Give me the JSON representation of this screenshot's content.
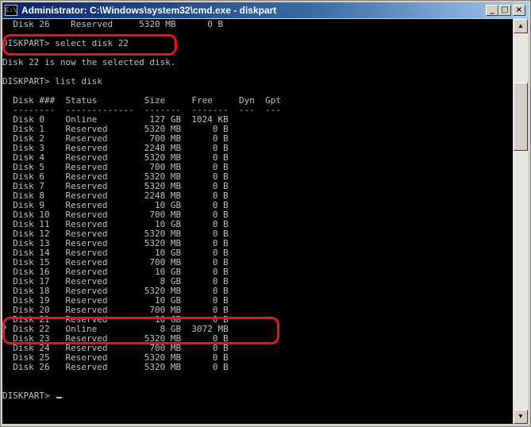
{
  "window": {
    "icon_text": "C:\\",
    "title": "Administrator: C:\\Windows\\system32\\cmd.exe - diskpart",
    "minimize_glyph": "_",
    "maximize_glyph": "□",
    "close_glyph": "×"
  },
  "console": {
    "lines": [
      "  Disk 26    Reserved     5320 MB      0 B",
      "",
      "DISKPART> select disk 22",
      "",
      "Disk 22 is now the selected disk.",
      "",
      "DISKPART> list disk",
      "",
      "  Disk ###  Status         Size     Free     Dyn  Gpt",
      "  --------  -------------  -------  -------  ---  ---",
      "  Disk 0    Online          127 GB  1024 KB",
      "  Disk 1    Reserved       5320 MB      0 B",
      "  Disk 2    Reserved        700 MB      0 B",
      "  Disk 3    Reserved       2248 MB      0 B",
      "  Disk 4    Reserved       5320 MB      0 B",
      "  Disk 5    Reserved        700 MB      0 B",
      "  Disk 6    Reserved       5320 MB      0 B",
      "  Disk 7    Reserved       5320 MB      0 B",
      "  Disk 8    Reserved       2248 MB      0 B",
      "  Disk 9    Reserved         10 GB      0 B",
      "  Disk 10   Reserved        700 MB      0 B",
      "  Disk 11   Reserved         10 GB      0 B",
      "  Disk 12   Reserved       5320 MB      0 B",
      "  Disk 13   Reserved       5320 MB      0 B",
      "  Disk 14   Reserved         10 GB      0 B",
      "  Disk 15   Reserved        700 MB      0 B",
      "  Disk 16   Reserved         10 GB      0 B",
      "  Disk 17   Reserved          8 GB      0 B",
      "  Disk 18   Reserved       5320 MB      0 B",
      "  Disk 19   Reserved         10 GB      0 B",
      "  Disk 20   Reserved        700 MB      0 B",
      "  Disk 21   Reserved         10 GB      0 B",
      "* Disk 22   Online            8 GB  3072 MB",
      "  Disk 23   Reserved       5320 MB      0 B",
      "  Disk 24   Reserved        700 MB      0 B",
      "  Disk 25   Reserved       5320 MB      0 B",
      "  Disk 26   Reserved       5320 MB      0 B",
      "",
      "",
      ""
    ],
    "prompt": "DISKPART> "
  },
  "scrollbar": {
    "up_glyph": "▲",
    "down_glyph": "▼"
  }
}
